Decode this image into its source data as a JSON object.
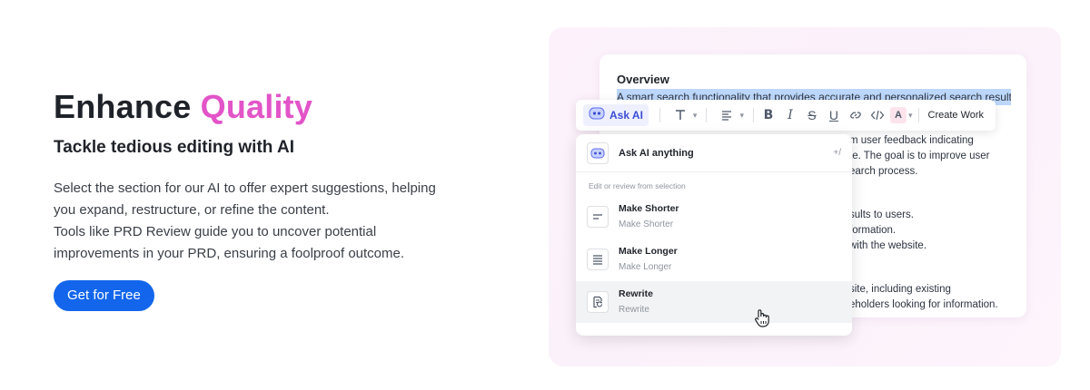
{
  "hero": {
    "title_main": "Enhance ",
    "title_accent": "Quality",
    "subtitle": "Tackle tedious editing with AI",
    "body_lines": [
      "Select the section for our AI to offer expert suggestions, helping",
      "you expand, restructure, or refine the content.",
      "Tools like PRD Review guide you to uncover potential",
      "improvements in your PRD, ensuring a foolproof outcome."
    ],
    "cta_label": "Get for Free"
  },
  "doc": {
    "heading": "Overview",
    "highlight": "A smart search functionality that provides accurate and personalized search results",
    "lines": [
      "m user feedback indicating",
      "te. The goal is to improve user",
      "earch process.",
      "sults to users.",
      "formation.",
      "with the website.",
      "site, including existing",
      "eholders looking for information."
    ]
  },
  "toolbar": {
    "ask_ai_label": "Ask AI",
    "create_work_label": "Create Work"
  },
  "menu": {
    "ask_anything_label": "Ask AI anything",
    "ask_anything_shortcut": "+/",
    "section_label": "Edit or review from selection",
    "items": [
      {
        "title": "Make Shorter",
        "subtitle": "Make Shorter",
        "icon": "text-shorter-icon"
      },
      {
        "title": "Make Longer",
        "subtitle": "Make Longer",
        "icon": "text-longer-icon"
      },
      {
        "title": "Rewrite",
        "subtitle": "Rewrite",
        "icon": "rewrite-icon"
      }
    ]
  },
  "colors": {
    "accent": "#e254c8",
    "cta": "#1366ec",
    "highlight": "#bcd7fb"
  }
}
